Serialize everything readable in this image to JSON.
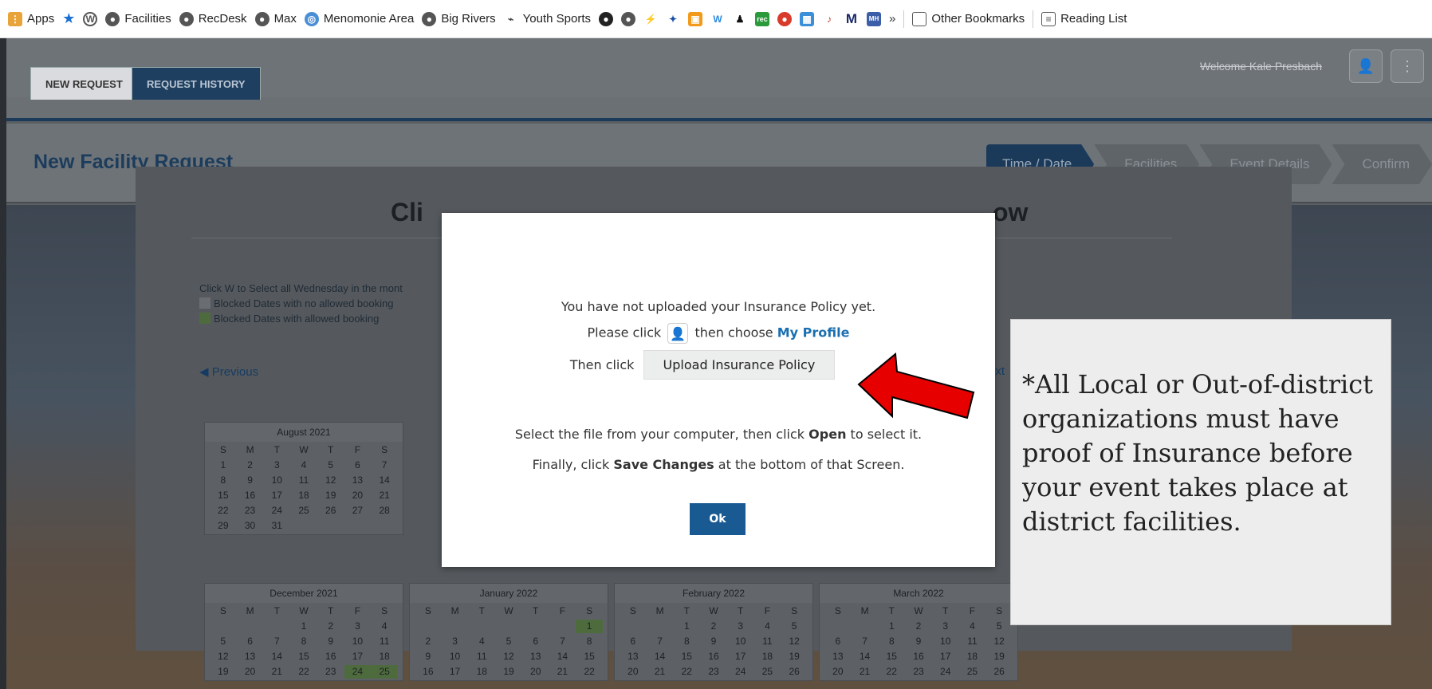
{
  "bookmarks": {
    "items": [
      "Apps",
      "Facilities",
      "RecDesk",
      "Max",
      "Menomonie Area",
      "Big Rivers",
      "Youth Sports"
    ],
    "overflow": "»",
    "other": "Other Bookmarks",
    "reading_list": "Reading List"
  },
  "header": {
    "welcome": "Welcome Kale Presbach"
  },
  "tabs": [
    "NEW REQUEST",
    "REQUEST HISTORY"
  ],
  "page_title": "New Facility Request",
  "steps": [
    "Time / Date",
    "Facilities",
    "Event Details",
    "Confirm"
  ],
  "background": {
    "title_left": "Cli",
    "title_right": "ow",
    "help_line": "Click W to Select all Wednesday in the mont",
    "legend": [
      "Blocked Dates with no allowed booking",
      "Blocked Dates with allowed booking"
    ],
    "prev": "Previous",
    "next": "ext",
    "calendars": [
      {
        "month": "August 2021",
        "days": [
          "S",
          "M",
          "T",
          "W",
          "T",
          "F",
          "S",
          "1",
          "2",
          "3",
          "4",
          "5",
          "6",
          "7",
          "8",
          "9",
          "10",
          "11",
          "12",
          "13",
          "14",
          "15",
          "16",
          "17",
          "18",
          "19",
          "20",
          "21",
          "22",
          "23",
          "24",
          "25",
          "26",
          "27",
          "28",
          "29",
          "30",
          "31"
        ]
      },
      {
        "month": "December 2021",
        "days": [
          "S",
          "M",
          "T",
          "W",
          "T",
          "F",
          "S",
          "",
          "",
          "",
          "1",
          "2",
          "3",
          "4",
          "5",
          "6",
          "7",
          "8",
          "9",
          "10",
          "11",
          "12",
          "13",
          "14",
          "15",
          "16",
          "17",
          "18",
          "19",
          "20",
          "21",
          "22",
          "23",
          "24",
          "25"
        ]
      },
      {
        "month": "January 2022",
        "days": [
          "S",
          "M",
          "T",
          "W",
          "T",
          "F",
          "S",
          "",
          "",
          "",
          "",
          "",
          "",
          "1",
          "2",
          "3",
          "4",
          "5",
          "6",
          "7",
          "8",
          "9",
          "10",
          "11",
          "12",
          "13",
          "14",
          "15",
          "16",
          "17",
          "18",
          "19",
          "20",
          "21",
          "22"
        ]
      },
      {
        "month": "February 2022",
        "days": [
          "S",
          "M",
          "T",
          "W",
          "T",
          "F",
          "S",
          "",
          "",
          "1",
          "2",
          "3",
          "4",
          "5",
          "6",
          "7",
          "8",
          "9",
          "10",
          "11",
          "12",
          "13",
          "14",
          "15",
          "16",
          "17",
          "18",
          "19",
          "20",
          "21",
          "22",
          "23",
          "24",
          "25",
          "26"
        ]
      },
      {
        "month": "March 2022",
        "days": [
          "S",
          "M",
          "T",
          "W",
          "T",
          "F",
          "S",
          "",
          "",
          "1",
          "2",
          "3",
          "4",
          "5",
          "6",
          "7",
          "8",
          "9",
          "10",
          "11",
          "12",
          "13",
          "14",
          "15",
          "16",
          "17",
          "18",
          "19",
          "20",
          "21",
          "22",
          "23",
          "24",
          "25",
          "26"
        ]
      }
    ]
  },
  "modal": {
    "line1": "You have not uploaded your Insurance Policy yet.",
    "line2_a": "Please click",
    "line2_b": "then choose",
    "line2_link": "My Profile",
    "line3_a": "Then click",
    "upload_button": "Upload Insurance Policy",
    "line4_a": "Select the file from your computer, then click",
    "line4_bold": "Open",
    "line4_b": "to select it.",
    "line5_a": "Finally, click",
    "line5_bold": "Save Changes",
    "line5_b": "at the bottom of that Screen.",
    "ok": "Ok"
  },
  "note": "*All Local or Out-of-district organizations must have proof of Insurance before your event takes place at district facilities.",
  "colors": {
    "accent": "#1a5a93",
    "arrow": "#e60000"
  }
}
